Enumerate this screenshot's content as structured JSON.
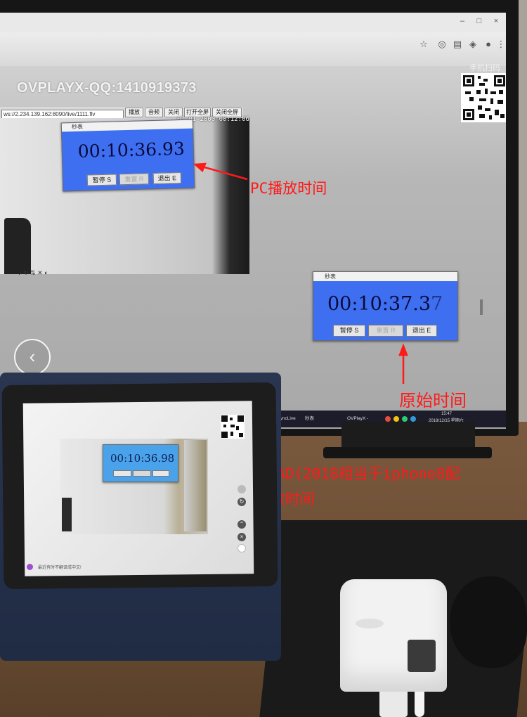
{
  "page": {
    "title": "OVPLAYX-QQ:1410919373",
    "qr_label": "手机扫码播放"
  },
  "player": {
    "url": "ws://2.234.139.162:8090/live/1111.flv",
    "buttons": [
      "播放",
      "音频",
      "关闭",
      "打开全屏",
      "关闭全屏"
    ],
    "video_date": "01-01-2000  00:12:06"
  },
  "stopwatches": {
    "pc": {
      "title": "秒表",
      "time": "00:10:36.93",
      "buttons": [
        "暂停 S",
        "重置 R",
        "退出 E"
      ]
    },
    "original": {
      "title": "秒表",
      "time_main": "00:10:37.3",
      "time_blur": "7",
      "buttons": [
        "暂停 S",
        "重置 R",
        "退出 E"
      ]
    },
    "ipad": {
      "time": "00:10:36.98"
    }
  },
  "taskbar": {
    "items": [
      "OvSyncLive",
      "秒表",
      "OVPlayX -"
    ],
    "clock_time": "15:47",
    "clock_date": "2018/12/15 星期六"
  },
  "annotations": {
    "pc": "PC播放时间",
    "original": "原始时间",
    "ipad_line1": "IOS-PAD(2018相当于iphone8配",
    "ipad_line2": "置)播放时间"
  },
  "ipad_chat": "最近有时不翻译成中文!",
  "colors": {
    "annotation": "#ff1a1a",
    "stopwatch_bg": "#3e6ff0",
    "ipad_stopwatch_bg": "#4aa3ea"
  },
  "icons": [
    "back-chevron-icon",
    "star-icon",
    "account-icon",
    "menu-icon",
    "qr-code-icon",
    "arrow-icon"
  ]
}
